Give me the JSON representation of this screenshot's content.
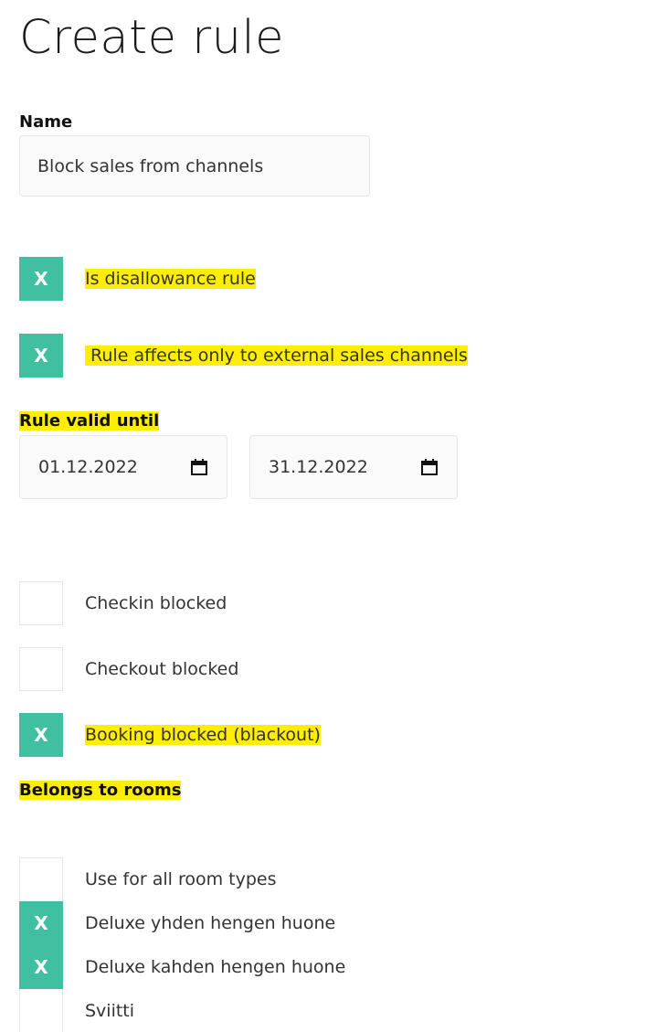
{
  "page": {
    "title": "Create rule"
  },
  "name": {
    "label": "Name",
    "value": "Block sales from channels"
  },
  "options": {
    "disallowance": {
      "label": "Is disallowance rule",
      "checked": true,
      "mark": "X"
    },
    "external": {
      "label": " Rule affects only to external sales channels",
      "checked": true,
      "mark": "X"
    }
  },
  "validity": {
    "label": "Rule valid until",
    "start": "01.12.2022",
    "end": "31.12.2022",
    "icon": "calendar-icon"
  },
  "blocks": {
    "checkin": {
      "label": "Checkin blocked",
      "checked": false
    },
    "checkout": {
      "label": "Checkout blocked",
      "checked": false
    },
    "booking": {
      "label": "Booking blocked (blackout)",
      "checked": true,
      "mark": "X"
    }
  },
  "rooms": {
    "label": "Belongs to rooms",
    "items": [
      {
        "label": "Use for all room types",
        "checked": false
      },
      {
        "label": "Deluxe yhden hengen huone",
        "checked": true,
        "mark": "X"
      },
      {
        "label": "Deluxe kahden hengen huone",
        "checked": true,
        "mark": "X"
      },
      {
        "label": "Sviitti",
        "checked": false
      }
    ]
  },
  "colors": {
    "accent": "#40c0a0",
    "highlight": "#ffee00"
  }
}
